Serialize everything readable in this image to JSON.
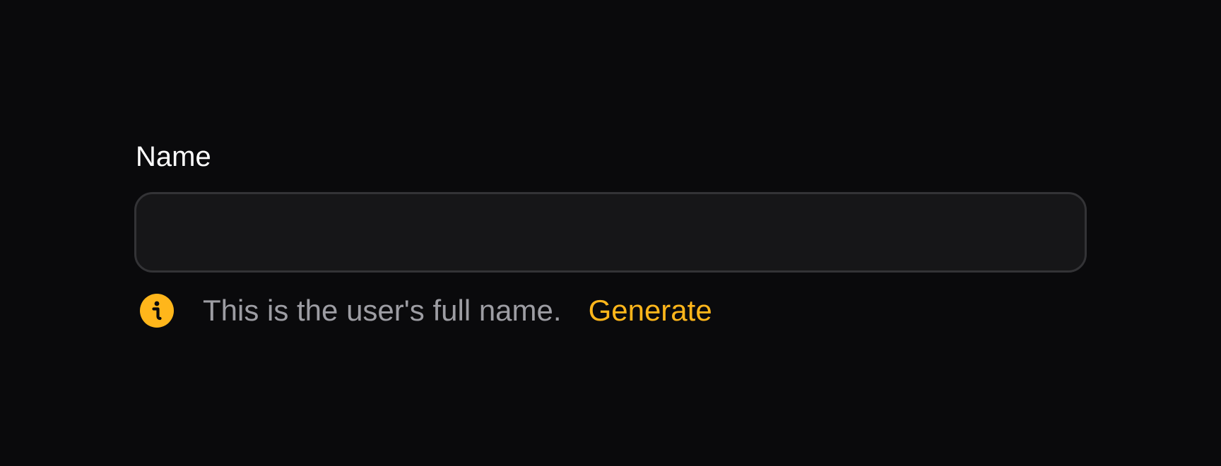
{
  "field": {
    "label": "Name",
    "value": "",
    "placeholder": ""
  },
  "help": {
    "icon": "info-icon",
    "text": "This is the user's full name.",
    "action_label": "Generate"
  },
  "colors": {
    "background": "#0a0a0c",
    "input_background": "#161618",
    "input_border": "#333336",
    "help_text": "#9d9da3",
    "accent": "#ffb61b"
  }
}
